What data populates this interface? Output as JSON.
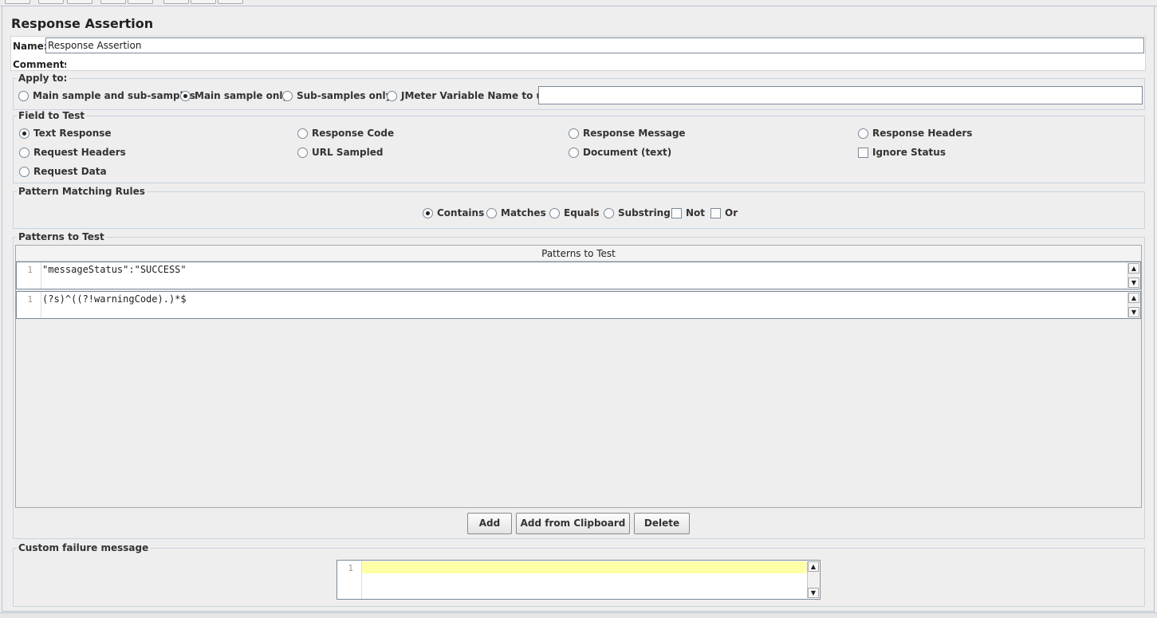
{
  "panel": {
    "title": "Response Assertion",
    "name_label": "Name:",
    "name_value": "Response Assertion",
    "comments_label": "Comments:"
  },
  "apply_to": {
    "legend": "Apply to:",
    "options": [
      {
        "label": "Main sample and sub-samples",
        "checked": false
      },
      {
        "label": "Main sample only",
        "checked": true
      },
      {
        "label": "Sub-samples only",
        "checked": false
      },
      {
        "label": "JMeter Variable Name to use",
        "checked": false
      }
    ],
    "variable_value": ""
  },
  "field_to_test": {
    "legend": "Field to Test",
    "options": [
      {
        "label": "Text Response",
        "checked": true
      },
      {
        "label": "Response Code",
        "checked": false
      },
      {
        "label": "Response Message",
        "checked": false
      },
      {
        "label": "Response Headers",
        "checked": false
      },
      {
        "label": "Request Headers",
        "checked": false
      },
      {
        "label": "URL Sampled",
        "checked": false
      },
      {
        "label": "Document (text)",
        "checked": false
      },
      {
        "label": "Request Data",
        "checked": false
      }
    ],
    "ignore_status": {
      "label": "Ignore Status",
      "checked": false
    }
  },
  "pattern_matching": {
    "legend": "Pattern Matching Rules",
    "options": [
      {
        "label": "Contains",
        "checked": true
      },
      {
        "label": "Matches",
        "checked": false
      },
      {
        "label": "Equals",
        "checked": false
      },
      {
        "label": "Substring",
        "checked": false
      }
    ],
    "checks": [
      {
        "label": "Not",
        "checked": false
      },
      {
        "label": "Or",
        "checked": false
      }
    ]
  },
  "patterns": {
    "legend": "Patterns to Test",
    "column_header": "Patterns to Test",
    "rows": [
      {
        "line": "1",
        "text": "\"messageStatus\":\"SUCCESS\""
      },
      {
        "line": "1",
        "text": "(?s)^((?!warningCode).)*$"
      }
    ],
    "buttons": {
      "add": "Add",
      "add_clipboard": "Add from Clipboard",
      "delete": "Delete"
    }
  },
  "failure_message": {
    "legend": "Custom failure message",
    "line": "1",
    "text": ""
  }
}
